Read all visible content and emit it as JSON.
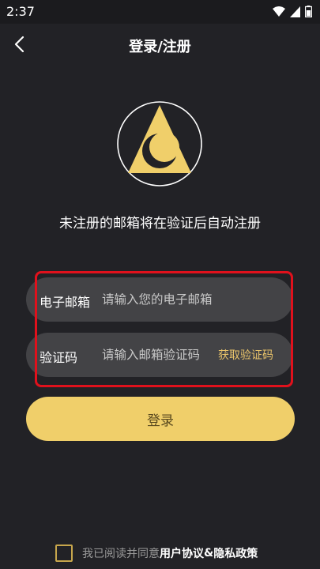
{
  "status_bar": {
    "time": "2:37",
    "icons": [
      "wifi-icon",
      "signal-icon",
      "battery-icon"
    ]
  },
  "nav": {
    "back_icon": "chevron-left-icon",
    "title": "登录/注册"
  },
  "logo": {
    "icon": "triangle-crescent-logo",
    "accent_color": "#f0cf6a"
  },
  "subtitle": "未注册的邮箱将在验证后自动注册",
  "form": {
    "email": {
      "label": "电子邮箱",
      "placeholder": "请输入您的电子邮箱",
      "value": ""
    },
    "code": {
      "label": "验证码",
      "placeholder": "请输入邮箱验证码",
      "value": "",
      "get_code_label": "获取验证码"
    }
  },
  "login_button": "登录",
  "agreement": {
    "checked": false,
    "prefix": "我已阅读并同意",
    "user_agreement": "用户协议",
    "amp": "&",
    "privacy_policy": "隐私政策"
  },
  "colors": {
    "background": "#222226",
    "field": "#434346",
    "accent": "#f0cf6a",
    "link": "#e8c36a",
    "highlight": "#e0111c"
  }
}
